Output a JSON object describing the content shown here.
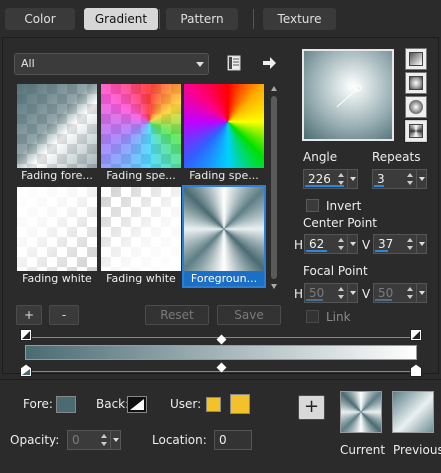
{
  "tabs": [
    {
      "label": "Color",
      "active": false
    },
    {
      "label": "Gradient",
      "active": true
    },
    {
      "label": "Pattern",
      "active": false
    },
    {
      "label": "Texture",
      "active": false
    }
  ],
  "library": {
    "filter_value": "All",
    "tiles": [
      {
        "label": "Fading fore...",
        "style": "fading-foreground-checker"
      },
      {
        "label": "Fading spe...",
        "style": "rainbow-checker"
      },
      {
        "label": "Fading spe...",
        "style": "rainbow"
      },
      {
        "label": "Fading white",
        "style": "white-checker"
      },
      {
        "label": "Fading white",
        "style": "white-checker-bright"
      },
      {
        "label": "Foregroun...",
        "style": "foreground-radial",
        "selected": true
      }
    ],
    "add_label": "+",
    "remove_label": "-",
    "reset_label": "Reset",
    "save_label": "Save"
  },
  "settings": {
    "angle_label": "Angle",
    "angle_value": "226",
    "repeats_label": "Repeats",
    "repeats_value": "3",
    "invert_label": "Invert",
    "invert_checked": false,
    "center_point_label": "Center Point",
    "center_h_label": "H",
    "center_h_value": "62",
    "center_v_label": "V",
    "center_v_value": "37",
    "focal_point_label": "Focal Point",
    "focal_h_label": "H",
    "focal_h_value": "50",
    "focal_v_label": "V",
    "focal_v_value": "50",
    "link_label": "Link",
    "link_checked": false
  },
  "editor": {
    "start_color": "#4a6b72",
    "end_color": "#ffffff"
  },
  "bottom": {
    "fore_label": "Fore:",
    "back_label": "Back:",
    "user_label": "User:",
    "opacity_label": "Opacity:",
    "opacity_value": "0",
    "location_label": "Location:",
    "location_value": "0",
    "add_label": "+",
    "current_label": "Current",
    "previous_label": "Previous"
  },
  "colors": {
    "accent": "#2d86de",
    "foreground": "#4a6b72",
    "user_swatch": "#f2c22a",
    "panel_bg": "#2b2b2b"
  }
}
